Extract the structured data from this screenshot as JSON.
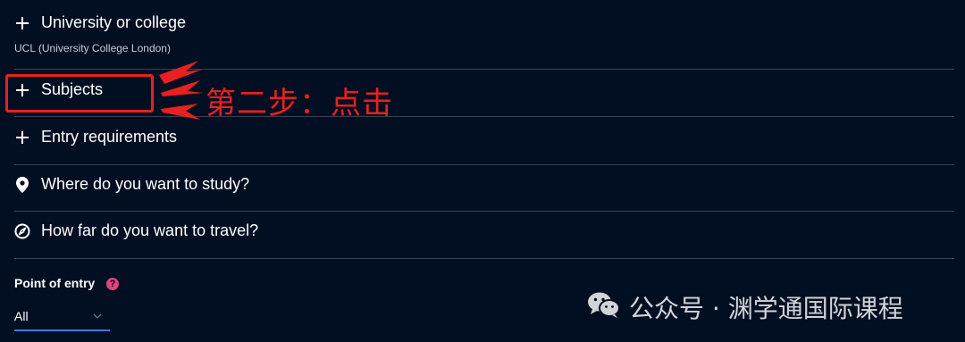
{
  "filters": {
    "university": {
      "label": "University or college",
      "selected": "UCL (University College London)",
      "icon": "plus-icon"
    },
    "subjects": {
      "label": "Subjects",
      "icon": "plus-icon"
    },
    "entry": {
      "label": "Entry requirements",
      "icon": "plus-icon"
    },
    "where": {
      "label": "Where do you want to study?",
      "icon": "map-pin-icon"
    },
    "travel": {
      "label": "How far do you want to travel?",
      "icon": "compass-icon"
    }
  },
  "point_of_entry": {
    "label": "Point of entry",
    "help": "?",
    "value": "All"
  },
  "annotation": {
    "text": "第二步：点击",
    "color": "#e8201f"
  },
  "watermark": {
    "text": "公众号 · 渊学通国际课程"
  },
  "colors": {
    "background": "#020e22",
    "divider": "#3a4353",
    "accent": "#3a7bd5",
    "help": "#e3437c"
  }
}
